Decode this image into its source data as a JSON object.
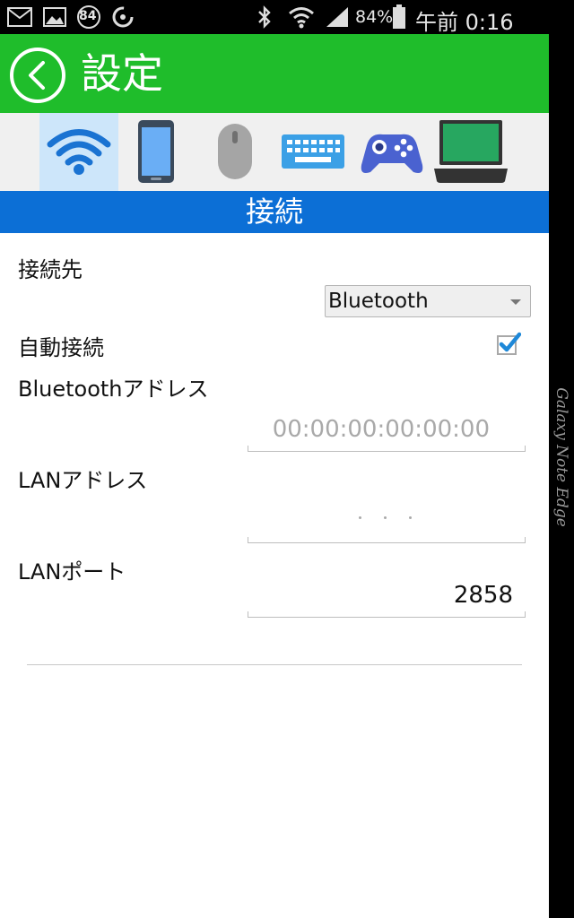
{
  "status_bar": {
    "battery": "84%",
    "time": "午前 0:16",
    "notification_badge": "84",
    "icons": [
      "mail-icon",
      "image-icon",
      "badge-84-icon",
      "sync-icon",
      "bluetooth-icon",
      "wifi-icon",
      "signal-icon",
      "battery-icon"
    ]
  },
  "header": {
    "title": "設定",
    "back_icon": "back-arrow-icon",
    "color": "#1fbd2b"
  },
  "tabs": [
    {
      "name": "wifi-icon",
      "active": true
    },
    {
      "name": "phone-icon",
      "active": false
    },
    {
      "name": "mouse-icon",
      "active": false
    },
    {
      "name": "keyboard-icon",
      "active": false
    },
    {
      "name": "gamepad-icon",
      "active": false
    },
    {
      "name": "laptop-icon",
      "active": false
    }
  ],
  "section": {
    "title": "接続",
    "color": "#0c6fd6"
  },
  "settings": {
    "connection_target_label": "接続先",
    "connection_target_value": "Bluetooth",
    "auto_connect_label": "自動接続",
    "auto_connect_checked": true,
    "bluetooth_address_label": "Bluetoothアドレス",
    "bluetooth_address_placeholder": "00:00:00:00:00:00",
    "lan_address_label": "LANアドレス",
    "lan_address_placeholder": ". . .",
    "lan_port_label": "LANポート",
    "lan_port_value": "2858"
  },
  "device_edge_label": "Galaxy Note Edge"
}
